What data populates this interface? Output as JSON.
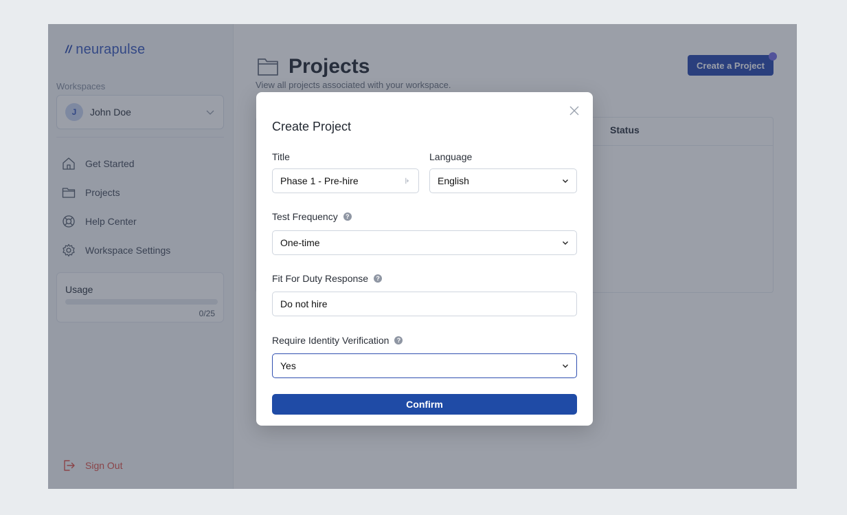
{
  "brand": {
    "name": "neurapulse",
    "mark": "//"
  },
  "sidebar": {
    "workspaces_label": "Workspaces",
    "workspace": {
      "initial": "J",
      "name": "John Doe"
    },
    "nav": [
      {
        "label": "Get Started",
        "icon": "home-icon"
      },
      {
        "label": "Projects",
        "icon": "folder-icon"
      },
      {
        "label": "Help Center",
        "icon": "lifebuoy-icon"
      },
      {
        "label": "Workspace Settings",
        "icon": "gear-icon"
      }
    ],
    "usage": {
      "title": "Usage",
      "count": "0/25",
      "fraction": 0
    },
    "sign_out": "Sign Out"
  },
  "main": {
    "title": "Projects",
    "subtitle": "View all projects associated with your workspace.",
    "create_button": "Create a Project",
    "table": {
      "columns": [
        "Status"
      ]
    }
  },
  "modal": {
    "title": "Create Project",
    "fields": {
      "title": {
        "label": "Title",
        "value": "Phase 1 - Pre-hire"
      },
      "language": {
        "label": "Language",
        "value": "English"
      },
      "test_frequency": {
        "label": "Test Frequency",
        "value": "One-time"
      },
      "fit_for_duty": {
        "label": "Fit For Duty Response",
        "value": "Do not hire"
      },
      "identity": {
        "label": "Require Identity Verification",
        "value": "Yes"
      }
    },
    "help_glyph": "?",
    "confirm": "Confirm"
  },
  "colors": {
    "primary": "#1f4ba6",
    "brand": "#3f5fbf",
    "danger": "#e0574f",
    "overlay": "rgba(38,46,66,0.46)"
  }
}
